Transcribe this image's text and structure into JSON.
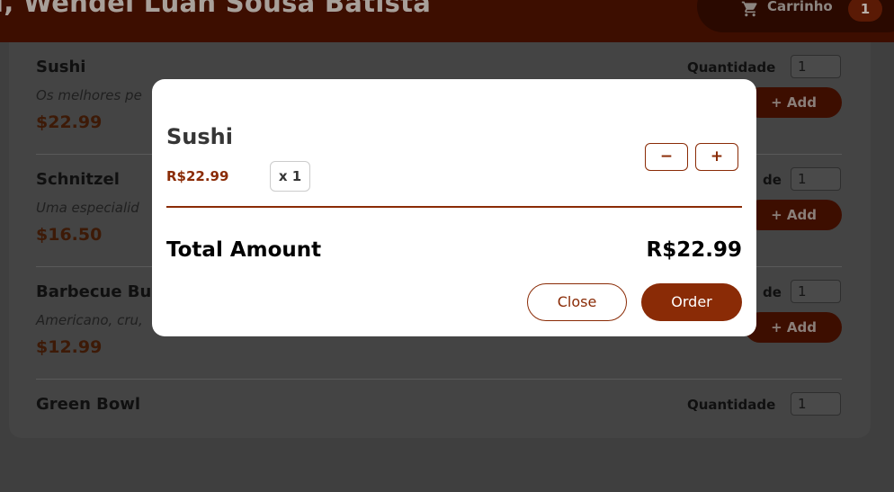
{
  "header": {
    "title": "l, Wendel Luan Sousa Batista",
    "cart_label": "Carrinho",
    "cart_count": "1",
    "cart_icon": "cart-icon"
  },
  "meals": [
    {
      "name": "Sushi",
      "description": "Os melhores pe",
      "price": "$22.99",
      "qty_label": "Quantidade",
      "qty_value": "1",
      "add_label": "+ Add"
    },
    {
      "name": "Schnitzel",
      "description": "Uma especialid",
      "price": "$16.50",
      "qty_label": "de",
      "qty_value": "1",
      "add_label": "+ Add"
    },
    {
      "name": "Barbecue Bur",
      "description": "Americano, cru,",
      "price": "$12.99",
      "qty_label": "de",
      "qty_value": "1",
      "add_label": "+ Add"
    },
    {
      "name": "Green Bowl",
      "description": "",
      "price": "",
      "qty_label": "Quantidade",
      "qty_value": "1",
      "add_label": ""
    }
  ],
  "modal": {
    "item_name": "Sushi",
    "item_price": "R$22.99",
    "item_amount": "x 1",
    "minus_label": "−",
    "plus_label": "+",
    "total_label": "Total Amount",
    "total_value": "R$22.99",
    "close_label": "Close",
    "order_label": "Order"
  }
}
